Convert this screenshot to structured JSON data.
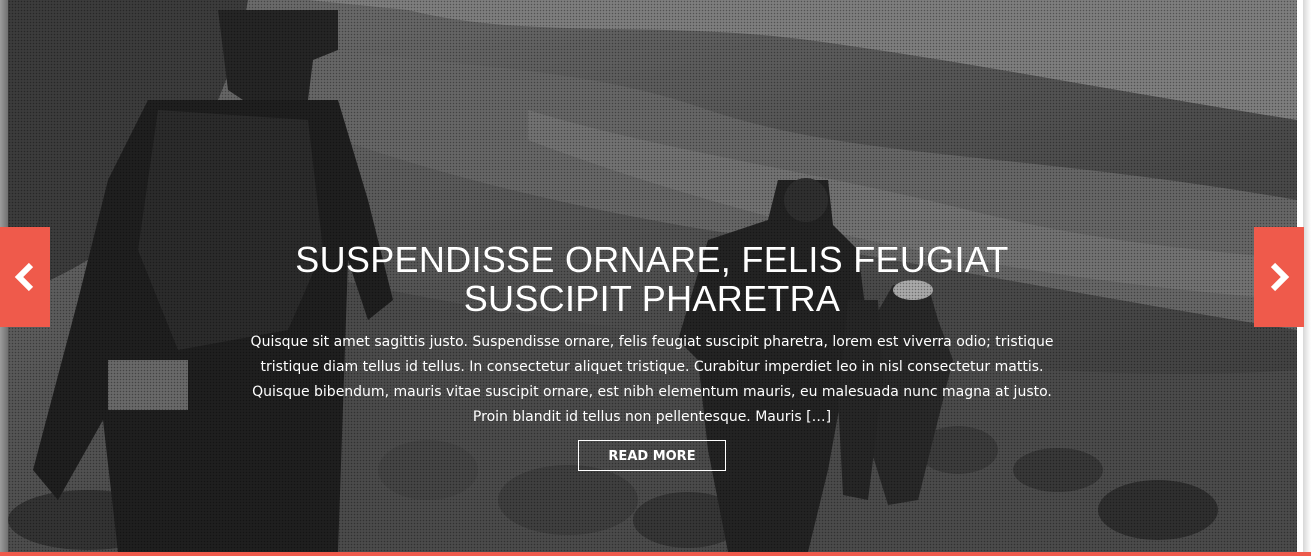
{
  "slide": {
    "title": "SUSPENDISSE ORNARE, FELIS FEUGIAT SUSCIPIT PHARETRA",
    "excerpt": "Quisque sit amet sagittis justo. Suspendisse ornare, felis feugiat suscipit pharetra, lorem est viverra odio; tristique tristique diam tellus id tellus. In consectetur aliquet tristique. Curabitur imperdiet leo in nisl consectetur mattis. Quisque bibendum, mauris vitae suscipit ornare, est nibh elementum mauris, eu malesuada nunc magna at justo. Proin blandit id tellus non pellentesque. Mauris […]",
    "read_more_label": "READ MORE"
  },
  "controls": {
    "prev_icon": "chevron-left-icon",
    "next_icon": "chevron-right-icon"
  },
  "colors": {
    "accent": "#ef5a4b",
    "text": "#ffffff"
  }
}
